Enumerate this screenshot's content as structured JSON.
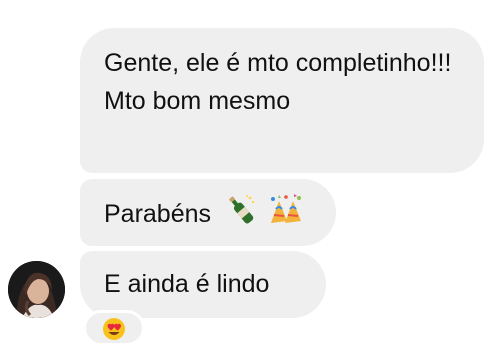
{
  "messages": [
    {
      "text": "Gente, ele é mto completinho!!! Mto bom mesmo"
    },
    {
      "text": "Parabéns",
      "emojis": [
        "bottle-with-popping-cork",
        "party-popper"
      ]
    },
    {
      "text": "E ainda é lindo"
    }
  ],
  "reaction": {
    "emoji": "heart-eyes-face"
  },
  "colors": {
    "bubble_bg": "#efefef",
    "text": "#111111",
    "page_bg": "#ffffff",
    "emoji_yellow": "#f8c21c",
    "heart_red": "#e8283c"
  }
}
